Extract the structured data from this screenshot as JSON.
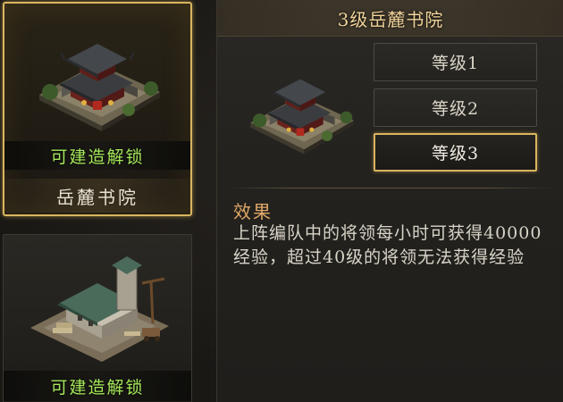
{
  "buildings": [
    {
      "unlock_label": "可建造解锁",
      "name": "岳麓书院",
      "selected": true
    },
    {
      "unlock_label": "可建造解锁",
      "selected": false
    }
  ],
  "detail": {
    "title": "3级岳麓书院",
    "levels": [
      {
        "label": "等级1",
        "active": false
      },
      {
        "label": "等级2",
        "active": false
      },
      {
        "label": "等级3",
        "active": true
      }
    ],
    "effect_heading": "效果",
    "effect_text": "上阵编队中的将领每小时可获得40000经验，超过40级的将领无法获得经验"
  },
  "colors": {
    "unlock_green": "#a6e85a",
    "selection_gold": "#d9b560",
    "title_gold": "#f0d39a",
    "effect_orange": "#e0a868"
  }
}
